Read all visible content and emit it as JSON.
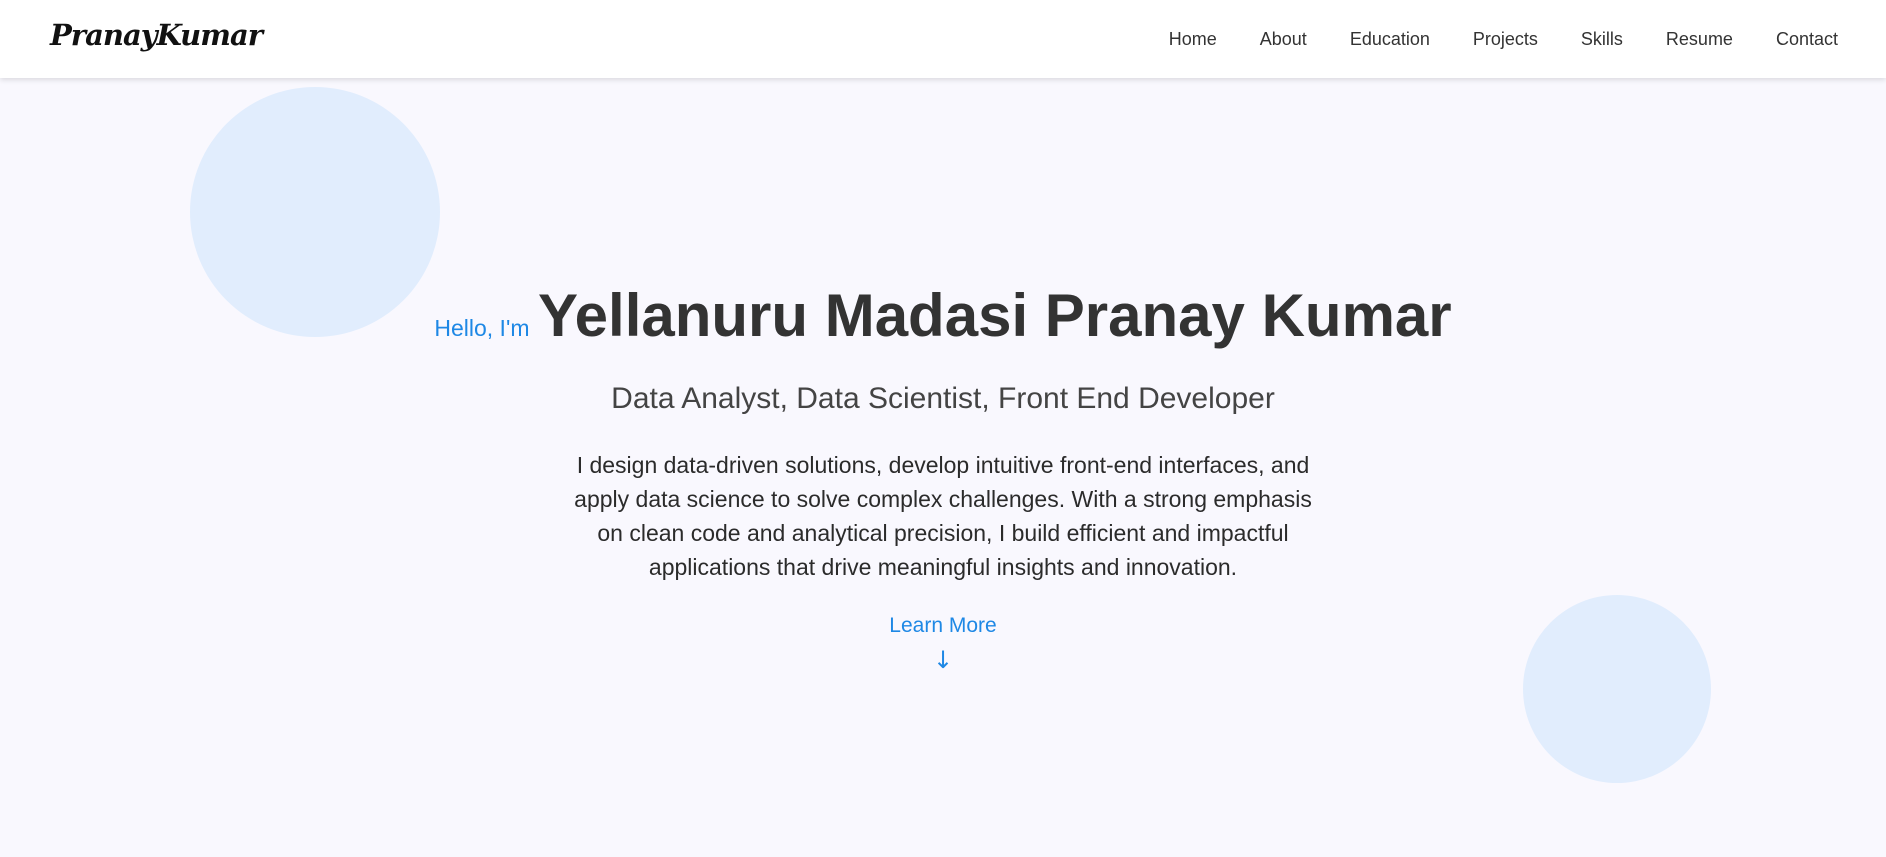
{
  "header": {
    "logo": "PranayKumar",
    "nav": [
      {
        "label": "Home"
      },
      {
        "label": "About"
      },
      {
        "label": "Education"
      },
      {
        "label": "Projects"
      },
      {
        "label": "Skills"
      },
      {
        "label": "Resume"
      },
      {
        "label": "Contact"
      }
    ]
  },
  "hero": {
    "greeting": "Hello, I'm",
    "name": "Yellanuru Madasi Pranay Kumar",
    "roles": "Data Analyst, Data Scientist, Front End Developer",
    "description": "I design data-driven solutions, develop intuitive front-end interfaces, and apply data science to solve complex challenges. With a strong emphasis on clean code and analytical precision, I build efficient and impactful applications that drive meaningful insights and innovation.",
    "cta_label": "Learn More",
    "cta_icon": "↓"
  },
  "colors": {
    "accent": "#1e88e5",
    "background": "#f9f8fe",
    "circle": "#e1edfd",
    "heading": "#333333"
  },
  "icons": {
    "cta": "arrow-down-icon"
  }
}
